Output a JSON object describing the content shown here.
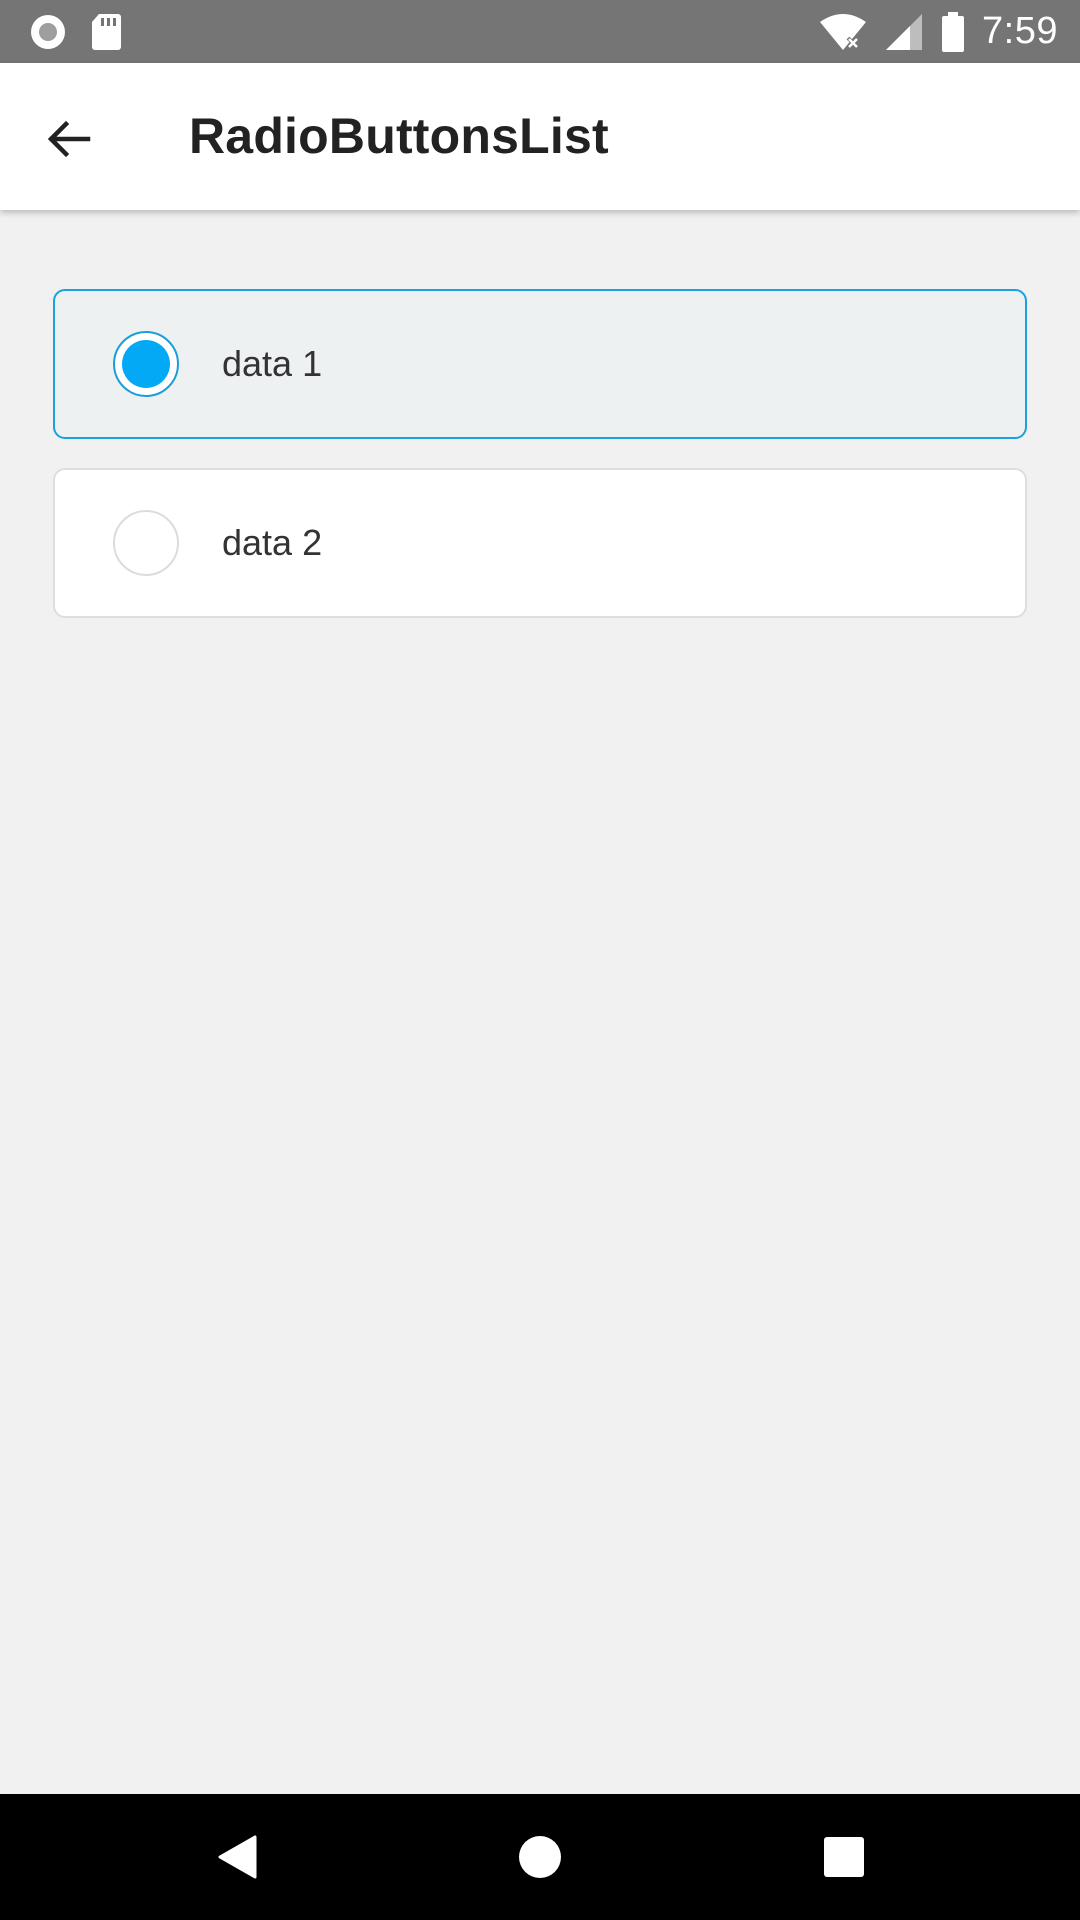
{
  "status_bar": {
    "time": "7:59",
    "left_icons": [
      "record-icon",
      "sd-card-icon"
    ],
    "right_icons": [
      "wifi-off-icon",
      "signal-icon",
      "battery-icon"
    ]
  },
  "app_bar": {
    "title": "RadioButtonsList",
    "back_icon": "arrow-back-icon"
  },
  "radio_list": {
    "accent_color": "#03a9f4",
    "items": [
      {
        "label": "data 1",
        "selected": true
      },
      {
        "label": "data 2",
        "selected": false
      }
    ]
  },
  "nav_bar": {
    "buttons": [
      "back-triangle-icon",
      "home-circle-icon",
      "recents-square-icon"
    ]
  }
}
